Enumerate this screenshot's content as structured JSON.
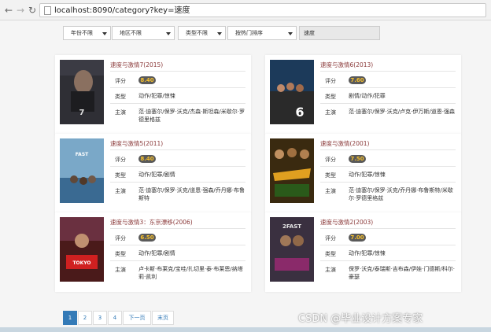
{
  "browser": {
    "url": "localhost:8090/category?key=速度"
  },
  "filters": {
    "year": "年份不限",
    "region": "地区不限",
    "type": "类型不限",
    "sort": "按热门排序",
    "search_value": "速度"
  },
  "labels": {
    "rating": "评分",
    "genre": "类型",
    "cast": "主演"
  },
  "movies": [
    {
      "title": "速度与激情7(2015)",
      "rating": "8.40",
      "genre": "动作/犯罪/惊悚",
      "cast": "范·迪塞尔/保罗·沃克/杰森·斯坦森/米歇尔·罗德里格兹",
      "poster_color": "#2f2f35"
    },
    {
      "title": "速度与激情6(2013)",
      "rating": "7.60",
      "genre": "剧情/动作/犯罪",
      "cast": "范·迪塞尔/保罗·沃克/卢克·伊万斯/道恩·强森",
      "poster_color": "#1c3a5a"
    },
    {
      "title": "速度与激情5(2011)",
      "rating": "8.40",
      "genre": "动作/犯罪/剧情",
      "cast": "范·迪塞尔/保罗·沃克/道恩·强森/乔丹娜·布鲁斯特",
      "poster_color": "#3a6a92"
    },
    {
      "title": "速度与激情(2001)",
      "rating": "7.50",
      "genre": "动作/犯罪/惊悚",
      "cast": "范·迪塞尔/保罗·沃克/乔丹娜·布鲁斯特/米歇尔·罗德里格兹",
      "poster_color": "#3a2a10"
    },
    {
      "title": "速度与激情3：东京漂移(2006)",
      "rating": "6.50",
      "genre": "动作/犯罪/剧情",
      "cast": "卢卡斯·布莱克/宝哇/扎切里·泰·布莱恩/纳塔莉·凯利",
      "poster_color": "#4a1a1a"
    },
    {
      "title": "速度与激情2(2003)",
      "rating": "7.00",
      "genre": "动作/犯罪/惊悚",
      "cast": "保罗·沃克/泰瑞斯·吉布森/伊娃·门德斯/科尔·豪瑟",
      "poster_color": "#3a3040"
    }
  ],
  "pagination": {
    "pages": [
      "1",
      "2",
      "3",
      "4"
    ],
    "next": "下一页",
    "last": "末页",
    "current": "1"
  },
  "watermark": "CSDN @毕业设计方案专家",
  "colors": {
    "accent": "#337ab7",
    "title": "#8b3a3a",
    "badge_bg": "#5a5a5a",
    "badge_text": "#f7c02b"
  }
}
